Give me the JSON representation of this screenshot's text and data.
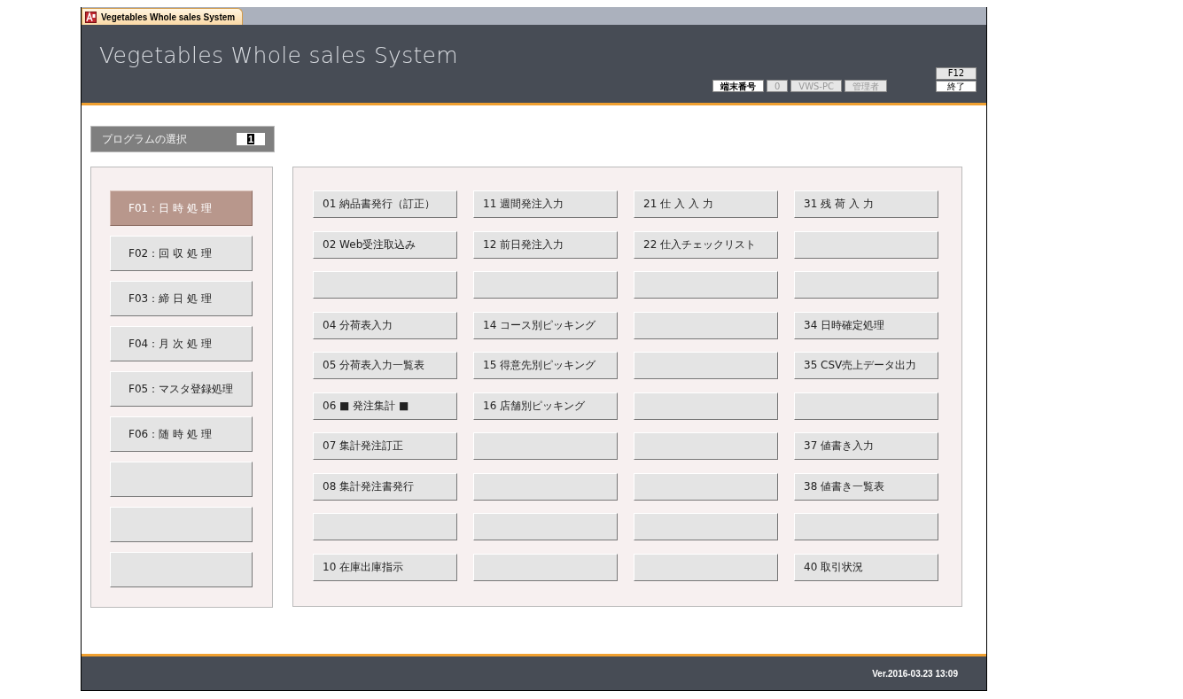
{
  "window": {
    "title": "Vegetables Whole sales System"
  },
  "header": {
    "title": "Vegetables Whole sales System",
    "status": [
      {
        "label": "端末番号",
        "kind": "label"
      },
      {
        "label": "0",
        "kind": "value"
      },
      {
        "label": "VWS-PC",
        "kind": "value"
      },
      {
        "label": "管理者",
        "kind": "value"
      }
    ],
    "key_hint": "F12",
    "exit_button": "終了"
  },
  "program_select": {
    "label": "プログラムの選択",
    "value": "1"
  },
  "categories": [
    {
      "kind": "program",
      "label": "F01：日 時 処 理",
      "selected": true
    },
    {
      "kind": "program",
      "label": "F02：回 収 処 理",
      "selected": false
    },
    {
      "kind": "program",
      "label": "F03：締 日 処 理",
      "selected": false
    },
    {
      "kind": "program",
      "label": "F04：月 次 処 理",
      "selected": false
    },
    {
      "kind": "program",
      "label": "F05：マスタ登録処理",
      "selected": false
    },
    {
      "kind": "program",
      "label": "F06：随 時 処 理",
      "selected": false
    },
    {
      "kind": "blank",
      "selected": false
    },
    {
      "kind": "blank",
      "selected": false
    },
    {
      "kind": "blank",
      "selected": false
    }
  ],
  "program_columns": [
    [
      {
        "kind": "program",
        "label": "01 納品書発行（訂正）"
      },
      {
        "kind": "program",
        "label": "02 Web受注取込み"
      },
      {
        "kind": "blank"
      },
      {
        "kind": "program",
        "label": "04 分荷表入力"
      },
      {
        "kind": "program",
        "label": "05 分荷表入力一覧表"
      },
      {
        "kind": "program",
        "label": "06 ■ 発注集計 ■"
      },
      {
        "kind": "program",
        "label": "07 集計発注訂正"
      },
      {
        "kind": "program",
        "label": "08 集計発注書発行"
      },
      {
        "kind": "blank"
      },
      {
        "kind": "program",
        "label": "10 在庫出庫指示"
      }
    ],
    [
      {
        "kind": "program",
        "label": "11 週間発注入力"
      },
      {
        "kind": "program",
        "label": "12 前日発注入力"
      },
      {
        "kind": "blank"
      },
      {
        "kind": "program",
        "label": "14 コース別ピッキング"
      },
      {
        "kind": "program",
        "label": "15 得意先別ピッキング"
      },
      {
        "kind": "program",
        "label": "16 店舗別ピッキング"
      },
      {
        "kind": "blank"
      },
      {
        "kind": "blank"
      },
      {
        "kind": "blank"
      },
      {
        "kind": "blank"
      }
    ],
    [
      {
        "kind": "program",
        "label": "21 仕 入 入 力"
      },
      {
        "kind": "program",
        "label": "22 仕入チェックリスト"
      },
      {
        "kind": "blank"
      },
      {
        "kind": "blank"
      },
      {
        "kind": "blank"
      },
      {
        "kind": "blank"
      },
      {
        "kind": "blank"
      },
      {
        "kind": "blank"
      },
      {
        "kind": "blank"
      },
      {
        "kind": "blank"
      }
    ],
    [
      {
        "kind": "program",
        "label": "31 残 荷 入 力"
      },
      {
        "kind": "blank"
      },
      {
        "kind": "blank"
      },
      {
        "kind": "program",
        "label": "34 日時確定処理"
      },
      {
        "kind": "program",
        "label": "35 CSV売上データ出力"
      },
      {
        "kind": "blank"
      },
      {
        "kind": "program",
        "label": "37 値書き入力"
      },
      {
        "kind": "program",
        "label": "38 値書き一覧表"
      },
      {
        "kind": "blank"
      },
      {
        "kind": "program",
        "label": "40 取引状況"
      }
    ]
  ],
  "status_bar": {
    "version": "Ver.2016-03.23 13:09"
  }
}
